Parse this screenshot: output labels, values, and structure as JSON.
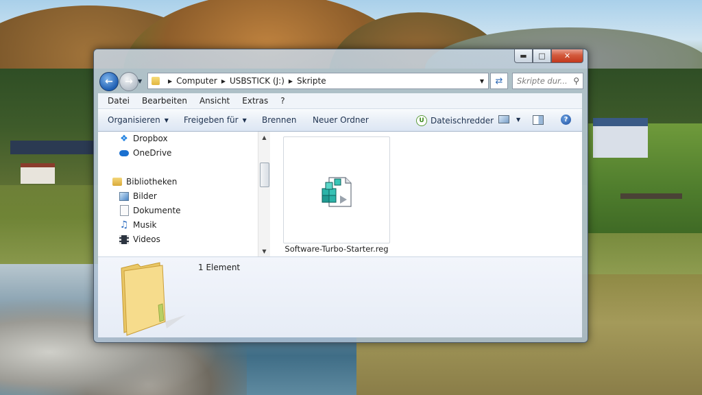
{
  "address_bar": {
    "crumbs": [
      "Computer",
      "USBSTICK (J:)",
      "Skripte"
    ]
  },
  "search": {
    "placeholder": "Skripte dur..."
  },
  "menu": [
    "Datei",
    "Bearbeiten",
    "Ansicht",
    "Extras",
    "?"
  ],
  "commands": {
    "organize": "Organisieren",
    "share": "Freigeben für",
    "burn": "Brennen",
    "new_folder": "Neuer Ordner",
    "shredder": "Dateischredder"
  },
  "nav_pane": {
    "items": [
      {
        "label": "Dropbox",
        "icon": "dropbox-icon"
      },
      {
        "label": "OneDrive",
        "icon": "onedrive-icon"
      },
      {
        "label": "Bibliotheken",
        "icon": "library-icon"
      },
      {
        "label": "Bilder",
        "icon": "pictures-icon"
      },
      {
        "label": "Dokumente",
        "icon": "documents-icon"
      },
      {
        "label": "Musik",
        "icon": "music-icon"
      },
      {
        "label": "Videos",
        "icon": "videos-icon"
      }
    ]
  },
  "files": [
    {
      "name": "Software-Turbo-Starter.reg",
      "icon": "registry-file-icon"
    }
  ],
  "details": {
    "count": "1 Element"
  },
  "colors": {
    "accent": "#1f5fb3",
    "close": "#c2371c",
    "command_text": "#1e3250"
  }
}
